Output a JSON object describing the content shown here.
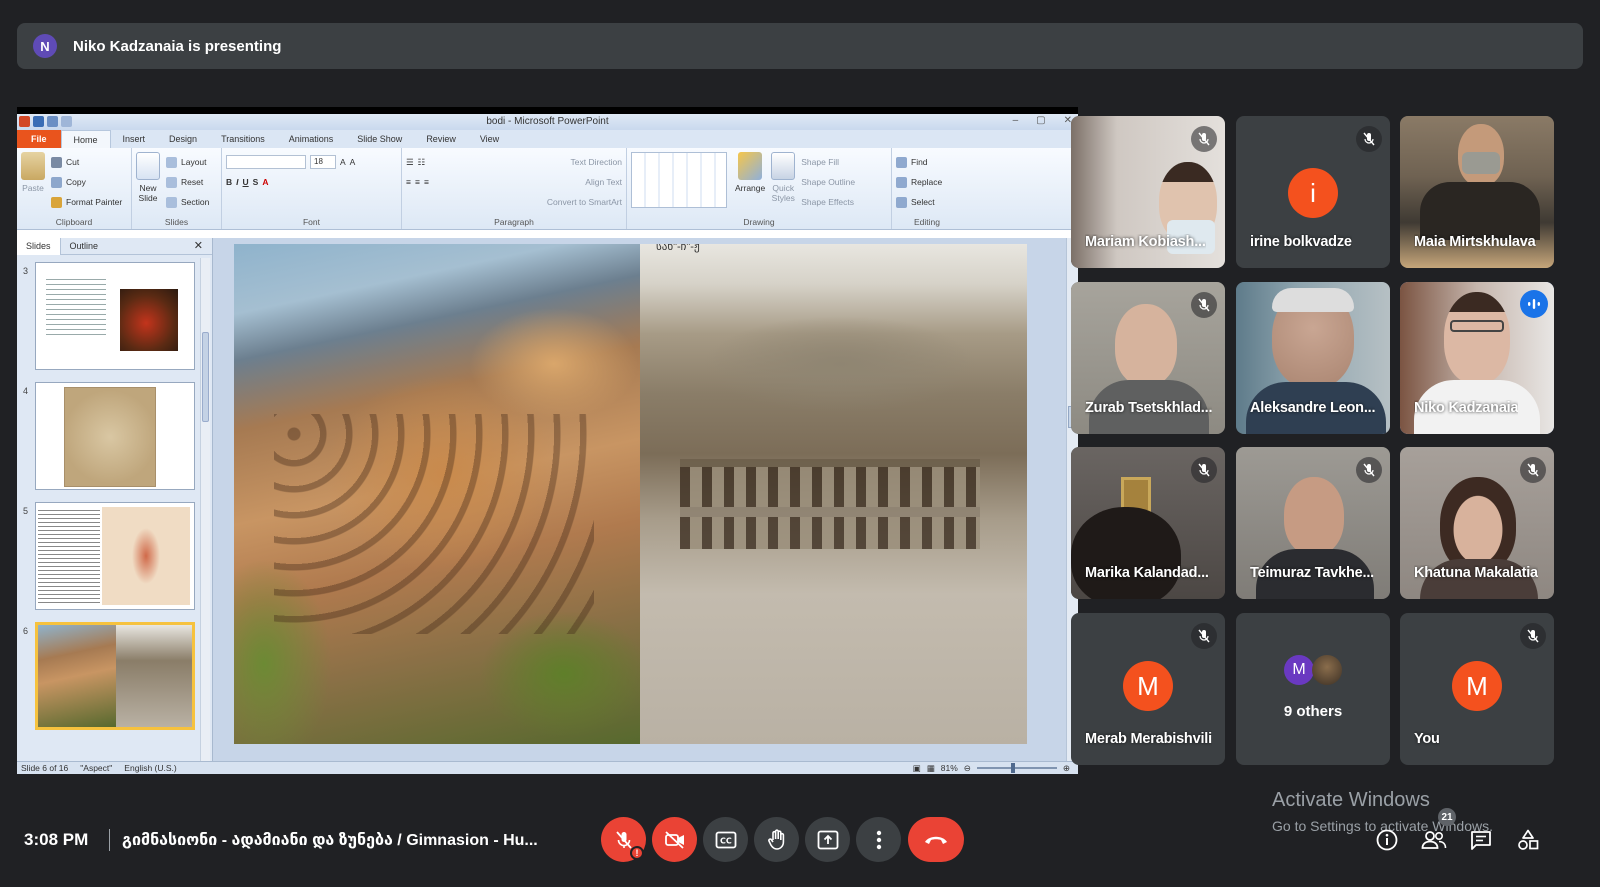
{
  "banner": {
    "avatar_letter": "N",
    "text": "Niko Kadzanaia is presenting"
  },
  "ppt": {
    "title": "bodi - Microsoft PowerPoint",
    "tabs": [
      "File",
      "Home",
      "Insert",
      "Design",
      "Transitions",
      "Animations",
      "Slide Show",
      "Review",
      "View"
    ],
    "clipboard": {
      "paste": "Paste",
      "cut": "Cut",
      "copy": "Copy",
      "format_painter": "Format Painter",
      "label": "Clipboard"
    },
    "slides_group": {
      "new_slide_1": "New",
      "new_slide_2": "Slide",
      "layout": "Layout",
      "reset": "Reset",
      "section": "Section",
      "label": "Slides"
    },
    "font_group": {
      "size": "18",
      "label": "Font"
    },
    "paragraph_group": {
      "text_direction": "Text Direction",
      "align_text": "Align Text",
      "convert": "Convert to SmartArt",
      "label": "Paragraph"
    },
    "drawing_group": {
      "arrange": "Arrange",
      "quick_1": "Quick",
      "quick_2": "Styles",
      "shape_fill": "Shape Fill",
      "shape_outline": "Shape Outline",
      "shape_effects": "Shape Effects",
      "label": "Drawing"
    },
    "editing_group": {
      "find": "Find",
      "replace": "Replace",
      "select": "Select",
      "label": "Editing"
    },
    "panel_tabs": {
      "slides": "Slides",
      "outline": "Outline"
    },
    "thumbs": [
      {
        "num": "3"
      },
      {
        "num": "4"
      },
      {
        "num": "5"
      },
      {
        "num": "6"
      }
    ],
    "slide_text": "სახ\"-ჩ\"-ჟ",
    "status": {
      "slide": "Slide 6 of 16",
      "theme": "\"Aspect\"",
      "lang": "English (U.S.)",
      "zoom": "81%"
    }
  },
  "participants": [
    {
      "name": "Mariam Kobiash...",
      "muted": true
    },
    {
      "name": "irine bolkvadze",
      "letter": "i",
      "muted": true
    },
    {
      "name": "Maia Mirtskhulava",
      "muted": false
    },
    {
      "name": "Zurab Tsetskhlad...",
      "muted": true
    },
    {
      "name": "Aleksandre Leon...",
      "muted": false
    },
    {
      "name": "Niko Kadzanaia",
      "speaking": true
    },
    {
      "name": "Marika Kalandad...",
      "muted": true
    },
    {
      "name": "Teimuraz Tavkhe...",
      "muted": true
    },
    {
      "name": "Khatuna Makalatia",
      "muted": true
    },
    {
      "name": "Merab Merabishvili",
      "letter": "M",
      "muted": true
    },
    {
      "name": "9 others",
      "letter": "M"
    },
    {
      "name": "You",
      "letter": "M",
      "muted": true
    }
  ],
  "bottom": {
    "time": "3:08 PM",
    "meeting": "გიმნასიონი - ადამიანი და ზუნება / Gimnasion - Hu...",
    "participant_count": "21"
  },
  "watermark": {
    "line1": "Activate Windows",
    "line2": "Go to Settings to activate Windows."
  },
  "colors": {
    "end_call": "#ea4335",
    "tile_bg": "#3c4043",
    "avatar_orange": "#f4511e",
    "speaking": "#8ab4f8"
  }
}
